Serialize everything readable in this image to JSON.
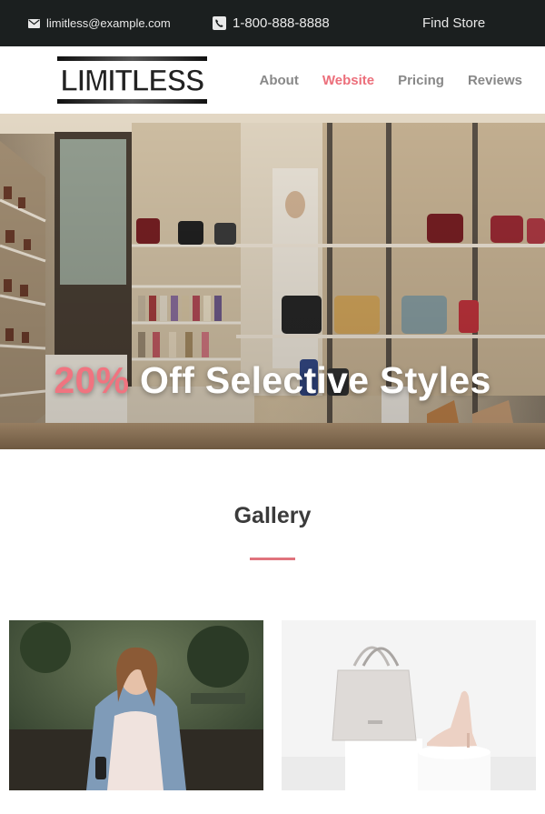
{
  "topbar": {
    "email": "limitless@example.com",
    "phone": "1-800-888-8888",
    "store_link": "Find Store",
    "email_icon": "envelope-icon",
    "phone_icon": "phone-icon"
  },
  "header": {
    "logo_text": "LIMITLESS",
    "nav": [
      {
        "label": "About",
        "active": false
      },
      {
        "label": "Website",
        "active": true
      },
      {
        "label": "Pricing",
        "active": false
      },
      {
        "label": "Reviews",
        "active": false
      }
    ]
  },
  "hero": {
    "highlight": "20%",
    "title_rest": " Off Selective Styles"
  },
  "gallery": {
    "title": "Gallery"
  },
  "colors": {
    "accent": "#ec6f7b",
    "topbar_bg": "#1b1f1f",
    "nav_text": "#888888"
  }
}
